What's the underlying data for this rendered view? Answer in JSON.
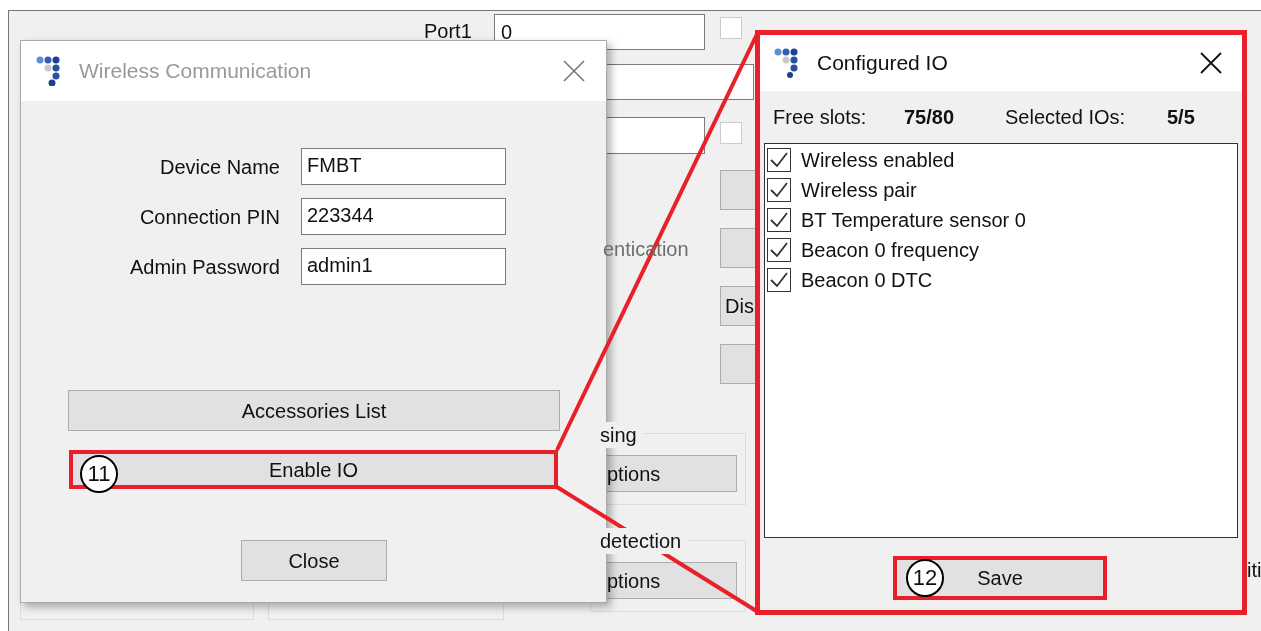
{
  "background_app": {
    "port_label": "Port1",
    "port_value": "0",
    "partial_label_1": "entication",
    "partial_button": "Dis",
    "group_1_label": "sing",
    "group_1_button": "ptions",
    "group_2_label": "detection",
    "group_2_button": "ptions",
    "edge_text": "iti",
    "checkboxes": [
      {
        "checked": false
      },
      {
        "checked": false
      }
    ]
  },
  "wireless_dialog": {
    "title": "Wireless Communication",
    "fields": [
      {
        "label": "Device Name",
        "value": "FMBT"
      },
      {
        "label": "Connection PIN",
        "value": "223344"
      },
      {
        "label": "Admin Password",
        "value": "admin1"
      }
    ],
    "accessories_button": "Accessories List",
    "enable_io_button": "Enable IO",
    "close_button": "Close"
  },
  "configured_io_dialog": {
    "title": "Configured IO",
    "free_slots_label": "Free slots:",
    "free_slots_value": "75/80",
    "selected_label": "Selected IOs:",
    "selected_value": "5/5",
    "items": [
      {
        "label": "Wireless enabled",
        "checked": true
      },
      {
        "label": "Wireless pair",
        "checked": true
      },
      {
        "label": "BT Temperature sensor 0",
        "checked": true
      },
      {
        "label": "Beacon 0 frequency",
        "checked": true
      },
      {
        "label": "Beacon 0 DTC",
        "checked": true
      }
    ],
    "save_button": "Save"
  },
  "callouts": [
    "11",
    "12"
  ]
}
